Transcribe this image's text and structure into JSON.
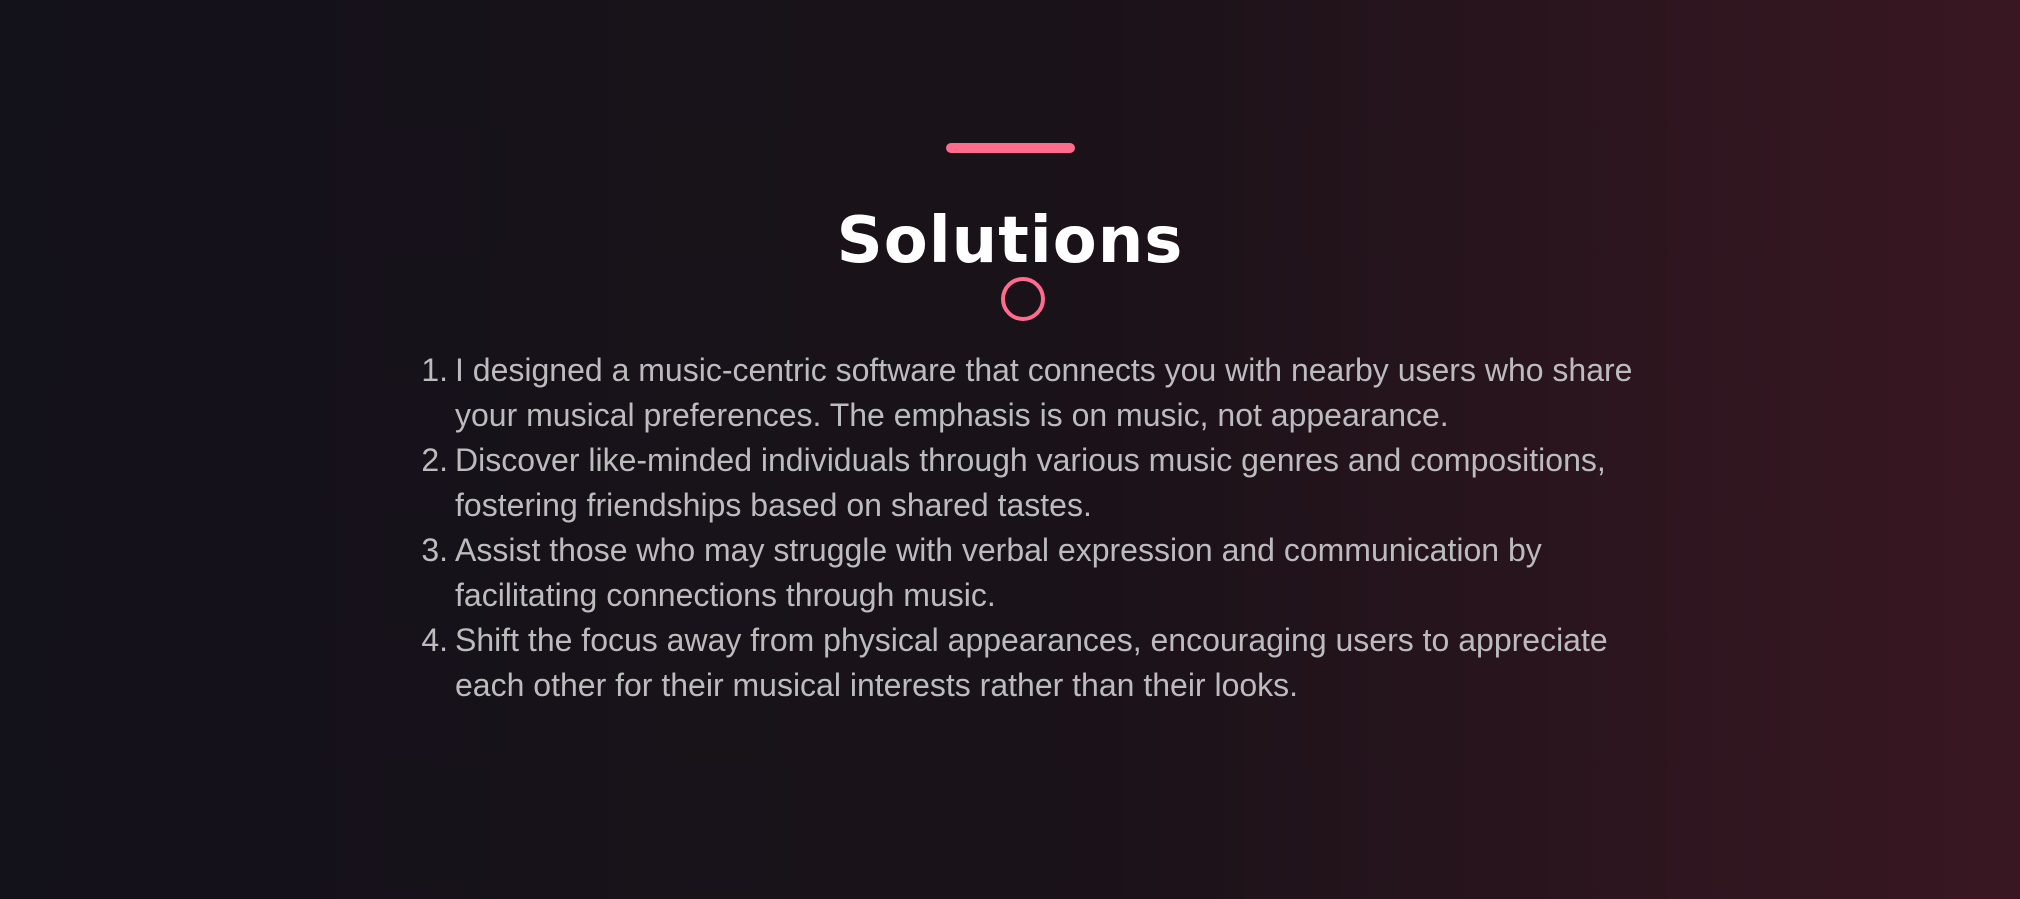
{
  "colors": {
    "accent": "#ff6b8d",
    "title": "#ffffff",
    "body_text": "#bcbcbf",
    "background_left": "#13111a",
    "background_right": "#391722"
  },
  "section": {
    "title": "Solutions",
    "icon": "ring-icon",
    "items": [
      {
        "number": "1.",
        "text": "I designed a music-centric software that connects you with nearby users who share your musical preferences. The emphasis is on music, not appearance."
      },
      {
        "number": "2.",
        "text": "Discover like-minded individuals through various music genres and compositions, fostering friendships based on shared tastes."
      },
      {
        "number": "3.",
        "text": "Assist those who may struggle with verbal expression and communication by facilitating connections through music."
      },
      {
        "number": "4.",
        "text": "Shift the focus away from physical appearances, encouraging users to appreciate each other for their musical interests rather than their looks."
      }
    ]
  }
}
